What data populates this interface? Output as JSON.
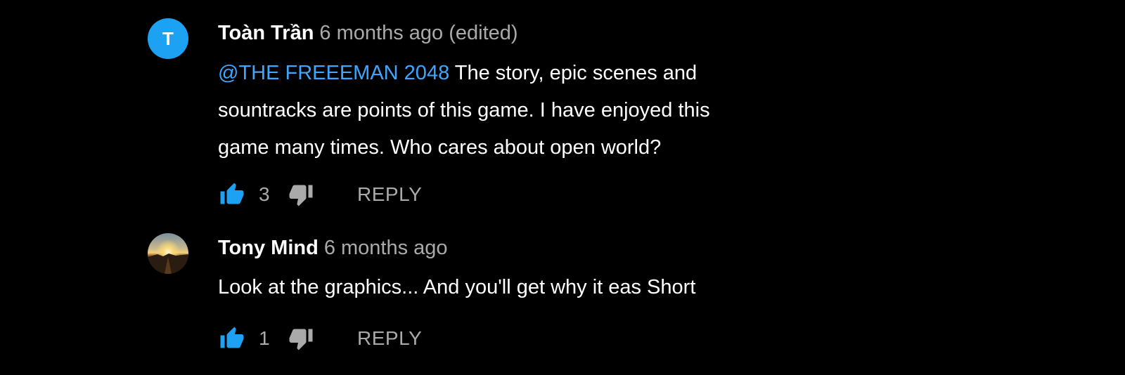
{
  "comments": [
    {
      "avatar_letter": "T",
      "author": "Toàn Trần",
      "meta": "6 months ago (edited)",
      "mention": "@THE FREEEMAN 2048",
      "text_lines": [
        " The story, epic scenes and",
        "sountracks are points of this game. I have enjoyed this",
        "game many times. Who cares about open world?"
      ],
      "likes": "3",
      "reply_label": "REPLY"
    },
    {
      "author": "Tony Mind",
      "meta": "6 months ago",
      "text": "Look at the graphics... And you'll get why it eas Short",
      "likes": "1",
      "reply_label": "REPLY"
    }
  ],
  "colors": {
    "background": "#000000",
    "accent_blue": "#3ea6ff",
    "like_blue": "#1da1f2",
    "muted": "#aaaaaa",
    "text": "#ffffff"
  },
  "icons": {
    "like": "thumbs-up-icon",
    "dislike": "thumbs-down-icon"
  }
}
